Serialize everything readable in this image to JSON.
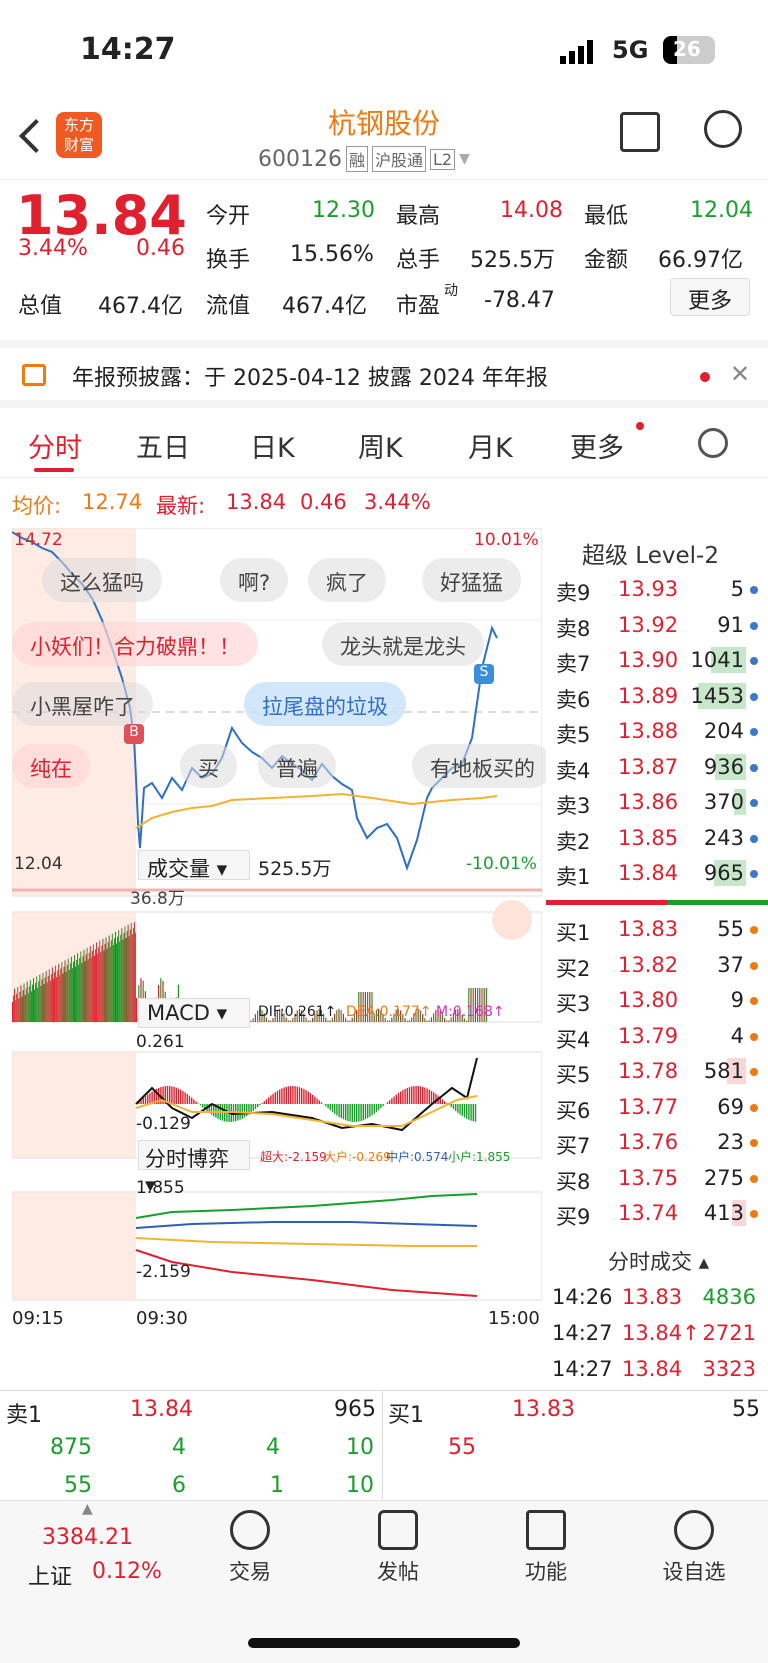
{
  "status": {
    "time": "14:27",
    "network": "5G",
    "battery": "26"
  },
  "header": {
    "title": "杭钢股份",
    "code": "600126",
    "tags": [
      "融",
      "沪股通",
      "L2"
    ]
  },
  "quote": {
    "price": "13.84",
    "pct": "3.44%",
    "chg": "0.46",
    "open_label": "今开",
    "open": "12.30",
    "high_label": "最高",
    "high": "14.08",
    "low_label": "最低",
    "low": "12.04",
    "turnover_label": "换手",
    "turnover": "15.56%",
    "vol_label": "总手",
    "vol": "525.5万",
    "amt_label": "金额",
    "amt": "66.97亿",
    "mcap_label": "总值",
    "mcap": "467.4亿",
    "float_label": "流值",
    "float": "467.4亿",
    "pe_label": "市盈",
    "pe_sup": "动",
    "pe": "-78.47",
    "more": "更多"
  },
  "notice": {
    "text": "年报预披露：于 2025-04-12 披露 2024 年年报"
  },
  "tabs": [
    "分时",
    "五日",
    "日K",
    "周K",
    "月K",
    "更多"
  ],
  "avg": {
    "avg_label": "均价:",
    "avg": "12.74",
    "last_label": "最新:",
    "last": "13.84",
    "chg": "0.46",
    "pct": "3.44%"
  },
  "chart": {
    "ymax": "14.72",
    "ymin": "12.04",
    "pct_hi": "10.01%",
    "pct_lo": "-10.01%",
    "bubbles": [
      "这么猛吗",
      "啊?",
      "疯了",
      "好猛猛",
      "小妖们！合力破鼎！！",
      "龙头就是龙头",
      "小黑屋咋了",
      "拉尾盘的垃圾",
      "纯在",
      "买",
      "普遍",
      "有地板买的"
    ],
    "vol_label": "成交量",
    "vol_total": "525.5万",
    "vol_max": "36.8万",
    "macd_label": "MACD",
    "dif": "DIF:0.261↑",
    "dea": "DEA:0.177↑",
    "m": "M:0.168↑",
    "macd_hi": "0.261",
    "macd_lo": "-0.129",
    "fsbo_label": "分时博弈",
    "fs_super": "超大:-2.159",
    "fs_big": "大户:-0.269",
    "fs_mid": "中户:0.574",
    "fs_small": "小户:1.855",
    "fs_hi": "1.855",
    "fs_lo": "-2.159",
    "t0": "09:15",
    "t1": "09:30",
    "t2": "15:00"
  },
  "level2": {
    "title": "超级 Level-2",
    "asks": [
      [
        "卖9",
        "13.93",
        "5"
      ],
      [
        "卖8",
        "13.92",
        "91"
      ],
      [
        "卖7",
        "13.90",
        "1041"
      ],
      [
        "卖6",
        "13.89",
        "1453"
      ],
      [
        "卖5",
        "13.88",
        "204"
      ],
      [
        "卖4",
        "13.87",
        "936"
      ],
      [
        "卖3",
        "13.86",
        "370"
      ],
      [
        "卖2",
        "13.85",
        "243"
      ],
      [
        "卖1",
        "13.84",
        "965"
      ]
    ],
    "bids": [
      [
        "买1",
        "13.83",
        "55"
      ],
      [
        "买2",
        "13.82",
        "37"
      ],
      [
        "买3",
        "13.80",
        "9"
      ],
      [
        "买4",
        "13.79",
        "4"
      ],
      [
        "买5",
        "13.78",
        "581"
      ],
      [
        "买6",
        "13.77",
        "69"
      ],
      [
        "买7",
        "13.76",
        "23"
      ],
      [
        "买8",
        "13.75",
        "275"
      ],
      [
        "买9",
        "13.74",
        "413"
      ]
    ],
    "trades_title": "分时成交",
    "trades": [
      [
        "14:26",
        "13.83",
        "4836"
      ],
      [
        "14:27",
        "13.84↑",
        "2721"
      ],
      [
        "14:27",
        "13.84",
        "3323"
      ]
    ]
  },
  "queue": {
    "s1": "卖1",
    "s1p": "13.84",
    "s1v": "965",
    "b1": "买1",
    "b1p": "13.83",
    "b1v": "55",
    "r1": [
      "875",
      "4",
      "4",
      "10"
    ],
    "r2": [
      "55",
      "6",
      "1",
      "10"
    ],
    "b_r1": "55"
  },
  "bottom": {
    "index_val": "3384.21",
    "index_name": "上证",
    "index_pct": "0.12%",
    "tabs": [
      "交易",
      "发帖",
      "功能",
      "设自选"
    ]
  }
}
